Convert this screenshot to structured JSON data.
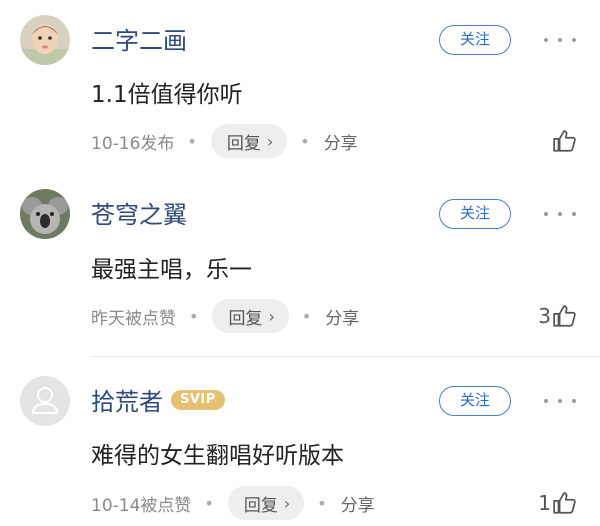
{
  "comments": [
    {
      "username": "二字二画",
      "follow_label": "关注",
      "text": "1.1倍值得你听",
      "meta": "10-16发布",
      "reply_label": "回复",
      "share_label": "分享",
      "like_count": ""
    },
    {
      "username": "苍穹之翼",
      "follow_label": "关注",
      "text": "最强主唱，乐一",
      "meta": "昨天被点赞",
      "reply_label": "回复",
      "share_label": "分享",
      "like_count": "3"
    },
    {
      "username": "拾荒者",
      "badge": "SVIP",
      "follow_label": "关注",
      "text": "难得的女生翻唱好听版本",
      "meta": "10-14被点赞",
      "reply_label": "回复",
      "share_label": "分享",
      "like_count": "1"
    }
  ],
  "colors": {
    "username": "#2e4a78",
    "follow": "#2f6cc0",
    "badge": "#e6c073"
  }
}
